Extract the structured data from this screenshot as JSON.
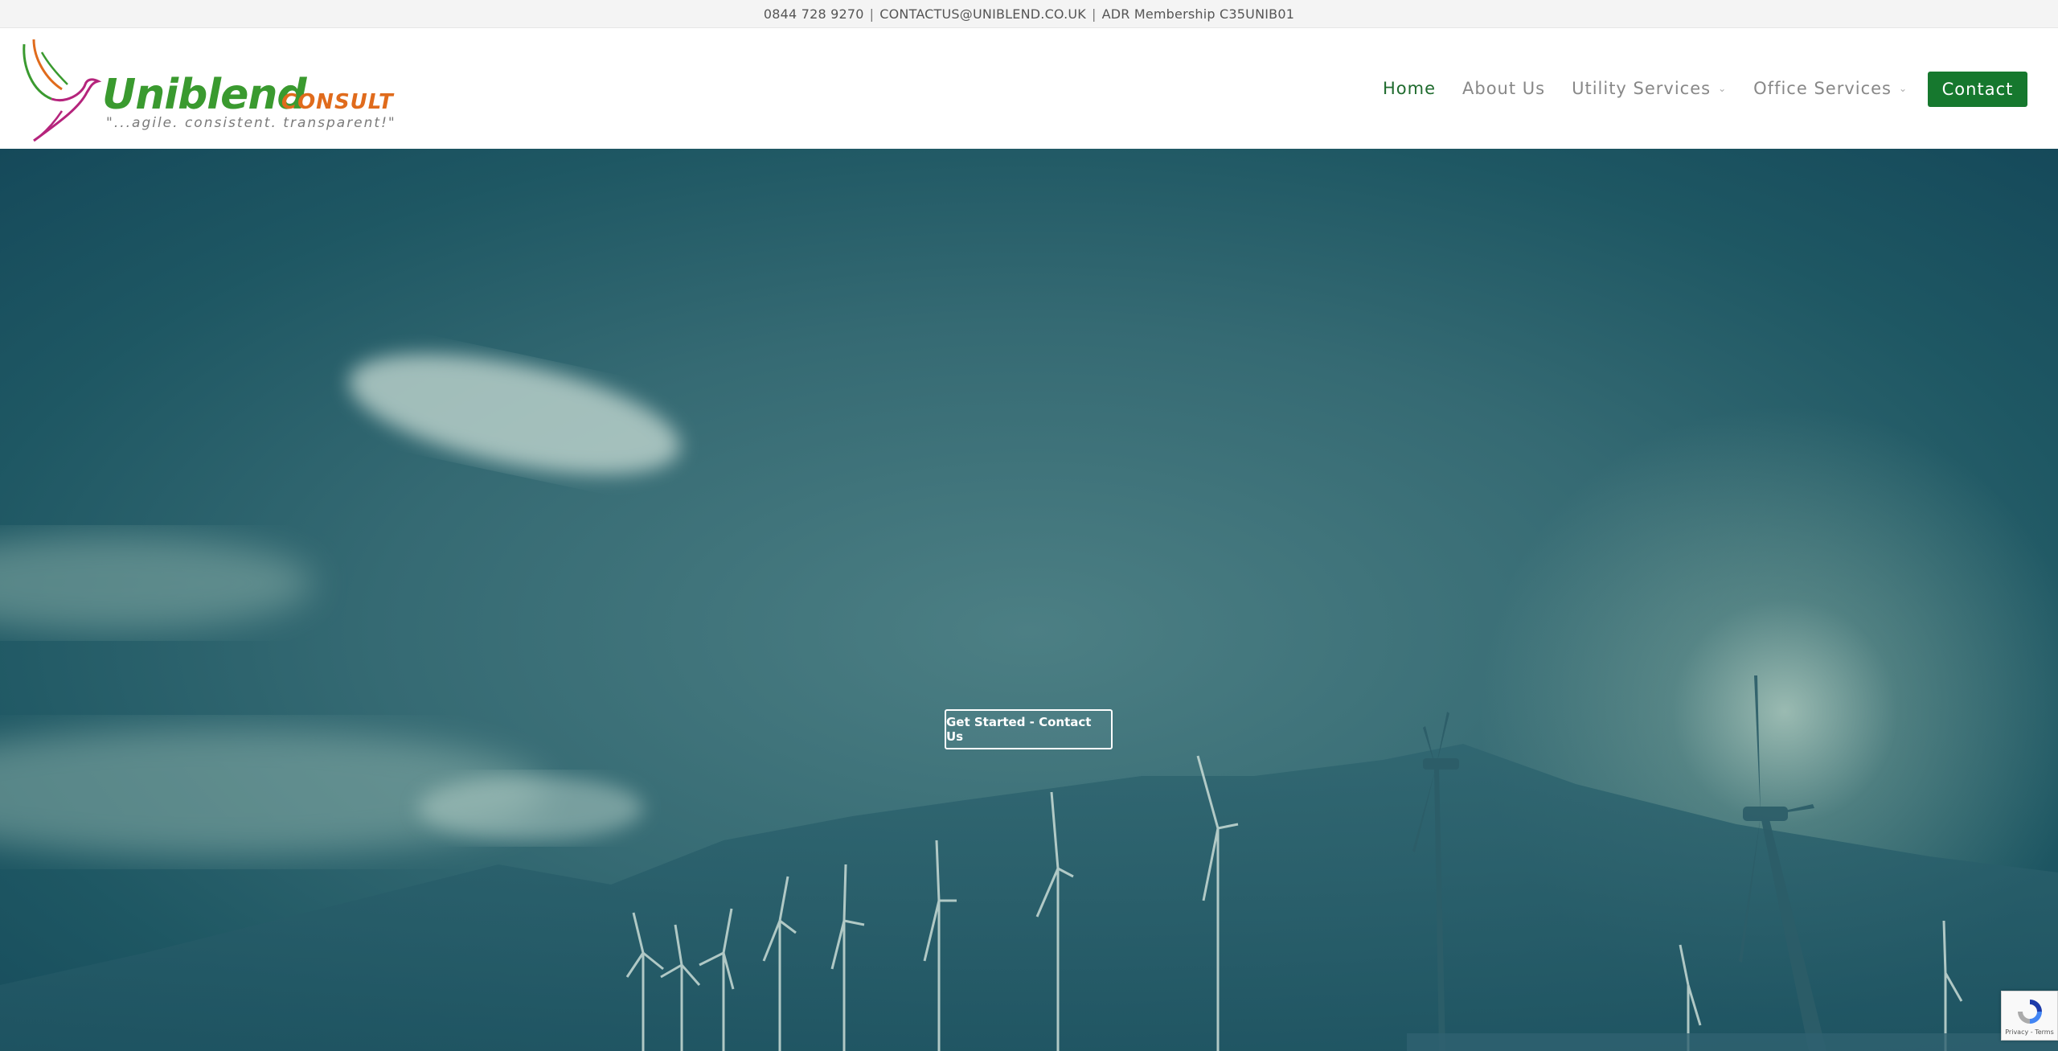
{
  "topbar": {
    "phone": "0844 728 9270",
    "email": "CONTACTUS@UNIBLEND.CO.UK",
    "membership": "ADR Membership C35UNIB01",
    "separator": "|"
  },
  "logo": {
    "word": "Uniblend",
    "suffix": "CONSULT",
    "tagline": "\"...agile. consistent. transparent!\"",
    "colors": {
      "green": "#3a9a2f",
      "orange": "#e06b1c",
      "magenta": "#b5247c"
    }
  },
  "nav": {
    "items": [
      {
        "label": "Home",
        "active": true,
        "has_dropdown": false
      },
      {
        "label": "About Us",
        "active": false,
        "has_dropdown": false
      },
      {
        "label": "Utility Services",
        "active": false,
        "has_dropdown": true
      },
      {
        "label": "Office Services",
        "active": false,
        "has_dropdown": true
      }
    ],
    "contact_label": "Contact",
    "accent": "#16782e"
  },
  "hero": {
    "cta_label": "Get Started - Contact Us"
  },
  "recaptcha": {
    "links": "Privacy - Terms"
  }
}
